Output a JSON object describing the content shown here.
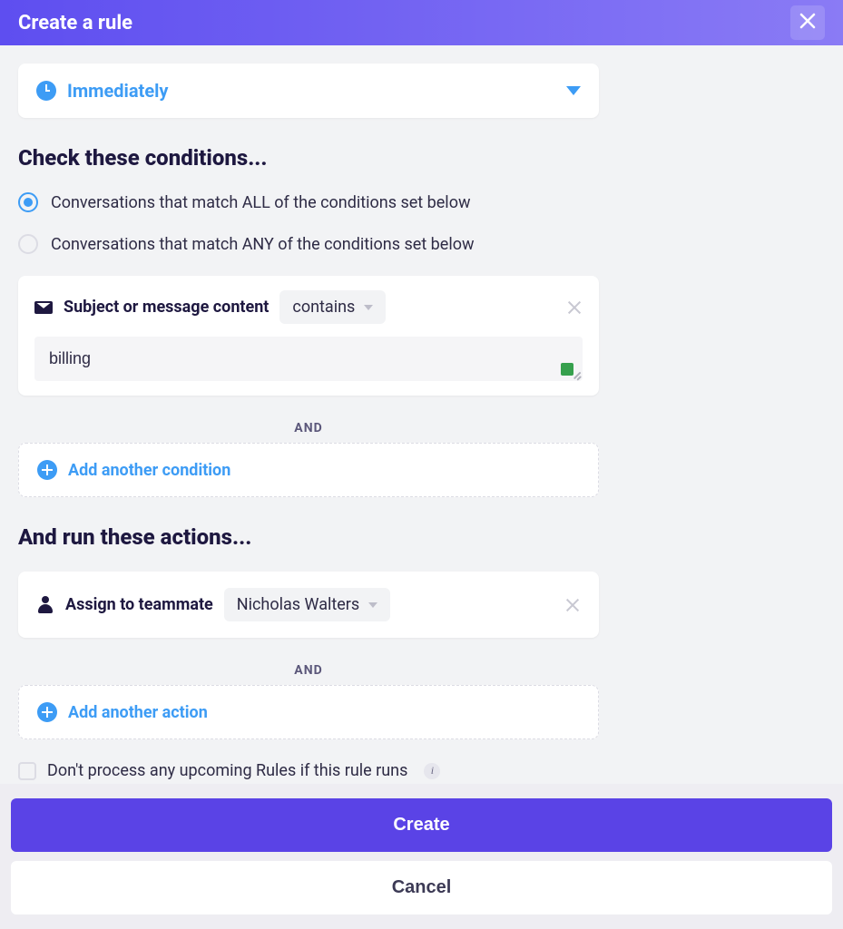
{
  "header": {
    "title": "Create a rule"
  },
  "trigger": {
    "label": "Immediately"
  },
  "conditions": {
    "heading": "Check these conditions...",
    "radio_all": "Conversations that match ALL of the conditions set below",
    "radio_any": "Conversations that match ANY of the conditions set below",
    "selected": "all",
    "rows": [
      {
        "field": "Subject or message content",
        "operator": "contains",
        "value": "billing"
      }
    ],
    "and": "AND",
    "add_label": "Add another condition"
  },
  "actions": {
    "heading": "And run these actions...",
    "rows": [
      {
        "type": "Assign to teammate",
        "value": "Nicholas Walters"
      }
    ],
    "and": "AND",
    "add_label": "Add another action"
  },
  "stop_processing": {
    "label": "Don't process any upcoming Rules if this rule runs"
  },
  "footer": {
    "create": "Create",
    "cancel": "Cancel"
  }
}
